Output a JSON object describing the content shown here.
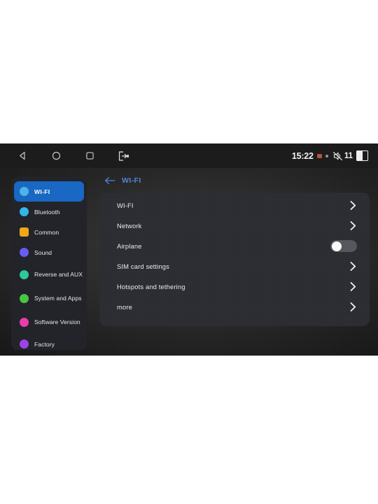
{
  "statusbar": {
    "clock": "15:22",
    "volume_level": "11",
    "icons": {
      "back": "back-triangle-icon",
      "home": "home-circle-icon",
      "recents": "recents-square-icon",
      "exit": "exit-app-icon",
      "signal_chip": "signal-chip-icon",
      "small_dot": "status-dot-icon",
      "mute": "volume-muted-icon",
      "sim": "dual-sim-indicator-icon"
    }
  },
  "sidebar": {
    "items": [
      {
        "label": "WI-FI",
        "icon": "wifi-icon",
        "color": "#4fb3e8",
        "active": true,
        "two_line": false,
        "glyph": "●",
        "shape": "circle"
      },
      {
        "label": "Bluetooth",
        "icon": "bluetooth-icon",
        "color": "#35b6e8",
        "active": false,
        "two_line": false,
        "glyph": "ᛗ",
        "shape": "circle"
      },
      {
        "label": "Common",
        "icon": "gear-icon",
        "color": "#f0a818",
        "active": false,
        "two_line": false,
        "glyph": "⚙",
        "shape": "square"
      },
      {
        "label": "Sound",
        "icon": "sound-icon",
        "color": "#6a5cf0",
        "active": false,
        "two_line": false,
        "glyph": "♫",
        "shape": "circle"
      },
      {
        "label": "Reverse and AUX",
        "icon": "reverse-aux-icon",
        "color": "#2ec89a",
        "active": false,
        "two_line": true,
        "glyph": "↻",
        "shape": "circle"
      },
      {
        "label": "System and Apps",
        "icon": "system-apps-icon",
        "color": "#49c640",
        "active": false,
        "two_line": true,
        "glyph": "✔",
        "shape": "circle"
      },
      {
        "label": "Software Version",
        "icon": "software-version-icon",
        "color": "#ea3cb0",
        "active": false,
        "two_line": true,
        "glyph": "ℹ",
        "shape": "circle"
      },
      {
        "label": "Factory",
        "icon": "factory-icon",
        "color": "#9a44e8",
        "active": false,
        "two_line": false,
        "glyph": "⏻",
        "shape": "circle"
      }
    ]
  },
  "main": {
    "header_title": "WI-FI",
    "back_icon": "back-arrow-icon",
    "rows": [
      {
        "label": "WI-FI",
        "control": "chevron"
      },
      {
        "label": "Network",
        "control": "chevron"
      },
      {
        "label": "Airplane",
        "control": "toggle",
        "toggle_on": false
      },
      {
        "label": "SIM card settings",
        "control": "chevron"
      },
      {
        "label": "Hotspots and tethering",
        "control": "chevron"
      },
      {
        "label": "more",
        "control": "chevron"
      }
    ]
  },
  "colors": {
    "accent_blue": "#1868c4",
    "header_blue": "#4f86d6",
    "card_bg": "#2a2c31",
    "sidebar_bg": "#222429",
    "screen_bg": "#141414"
  }
}
